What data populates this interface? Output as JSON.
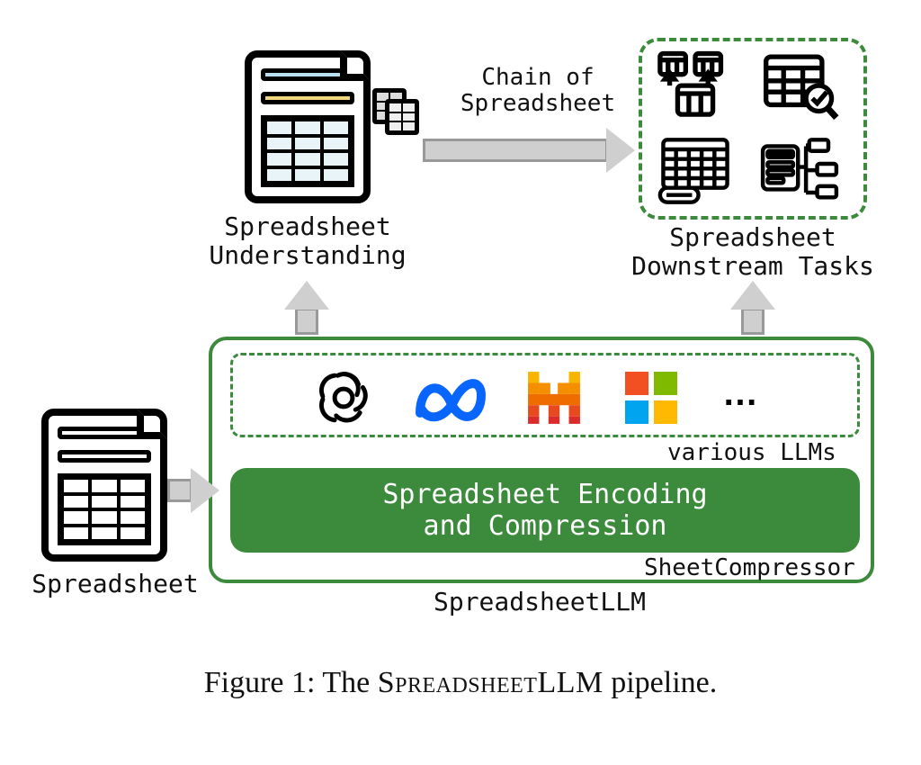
{
  "labels": {
    "spreadsheet": "Spreadsheet",
    "understanding_l1": "Spreadsheet",
    "understanding_l2": "Understanding",
    "chain_l1": "Chain of",
    "chain_l2": "Spreadsheet",
    "downstream_l1": "Spreadsheet",
    "downstream_l2": "Downstream Tasks",
    "various_llms": "various LLMs",
    "encoding_l1": "Spreadsheet Encoding",
    "encoding_l2": "and Compression",
    "sheetcompressor": "SheetCompressor",
    "spreadsheetllm": "SpreadsheetLLM",
    "ellipsis": "…"
  },
  "logos": {
    "openai": "openai-icon",
    "meta": "meta-icon",
    "mistral": "mistral-icon",
    "microsoft": "microsoft-icon"
  },
  "caption": {
    "prefix": "Figure 1: The ",
    "name": "SpreadsheetLLM",
    "suffix": " pipeline."
  },
  "chart_data": {
    "type": "diagram",
    "nodes": [
      {
        "id": "spreadsheet",
        "label": "Spreadsheet",
        "role": "input"
      },
      {
        "id": "spreadsheetllm",
        "label": "SpreadsheetLLM",
        "role": "system",
        "contains": [
          "sheetcompressor",
          "llms"
        ]
      },
      {
        "id": "sheetcompressor",
        "label": "SheetCompressor",
        "sublabel": "Spreadsheet Encoding and Compression",
        "role": "module"
      },
      {
        "id": "llms",
        "label": "various LLMs",
        "members": [
          "OpenAI",
          "Meta",
          "Mistral",
          "Microsoft",
          "…"
        ],
        "role": "module"
      },
      {
        "id": "understanding",
        "label": "Spreadsheet Understanding",
        "role": "intermediate"
      },
      {
        "id": "downstream",
        "label": "Spreadsheet Downstream Tasks",
        "role": "output"
      }
    ],
    "edges": [
      {
        "from": "spreadsheet",
        "to": "spreadsheetllm"
      },
      {
        "from": "spreadsheetllm",
        "to": "understanding"
      },
      {
        "from": "spreadsheetllm",
        "to": "downstream"
      },
      {
        "from": "understanding",
        "to": "downstream",
        "label": "Chain of Spreadsheet"
      }
    ]
  }
}
